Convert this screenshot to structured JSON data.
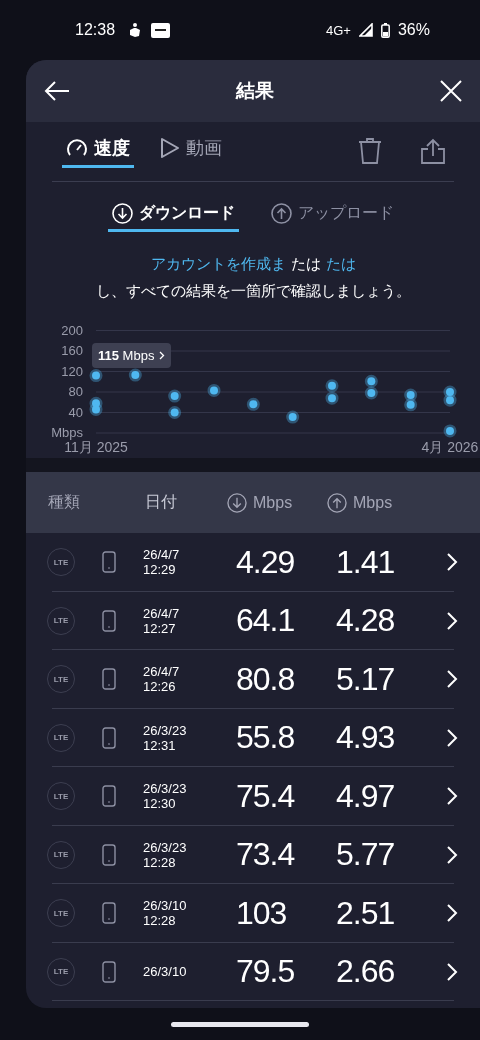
{
  "status_bar": {
    "time": "12:38",
    "network": "4G+",
    "battery": "36%"
  },
  "header": {
    "title": "結果"
  },
  "tabs": [
    {
      "label": "速度",
      "kind": "speed",
      "selected": true
    },
    {
      "label": "動画",
      "kind": "video",
      "selected": false
    }
  ],
  "direction_tabs": [
    {
      "label": "ダウンロード",
      "kind": "download",
      "selected": true
    },
    {
      "label": "アップロード",
      "kind": "upload",
      "selected": false
    }
  ],
  "notice": {
    "lines": [
      [
        {
          "text": "アカウントを作成ま",
          "link": true
        },
        {
          "text": "たは",
          "link": false
        },
        {
          "text": "たは",
          "link": true
        }
      ],
      [
        {
          "text": "し、すべての結果を一箇所で確認しましょう。",
          "link": false
        }
      ]
    ]
  },
  "chart": {
    "tooltip": "**115** Mbps",
    "chart_data": {
      "type": "scatter",
      "ylabel": "Mbps",
      "ylim": [
        0,
        200
      ],
      "yticks": [
        40,
        80,
        120,
        160,
        200
      ],
      "grid": true,
      "categories": [
        "11月 2025",
        null,
        null,
        null,
        null,
        null,
        null,
        null,
        null,
        "4月 2026"
      ],
      "series": [
        {
          "color": "#4fb8f0",
          "values": [
            112,
            113,
            72,
            83,
            56,
            31,
            92,
            101,
            74,
            80
          ]
        },
        {
          "color": "#4fb8f0",
          "values": [
            58,
            null,
            40,
            null,
            null,
            null,
            68,
            78,
            55,
            64
          ]
        },
        {
          "color": "#4fb8f0",
          "values": [
            46,
            null,
            null,
            null,
            null,
            null,
            null,
            null,
            null,
            4
          ]
        }
      ]
    }
  },
  "table": {
    "columns": [
      {
        "label": "種類",
        "kind": "text"
      },
      {
        "label": "日付",
        "kind": "text"
      },
      {
        "label": "Mbps",
        "kind": "download"
      },
      {
        "label": "Mbps",
        "kind": "upload"
      }
    ],
    "rows": [
      {
        "type": "LTE",
        "date": "26/4/7",
        "time": "12:29",
        "download": "4.29",
        "upload": "1.41"
      },
      {
        "type": "LTE",
        "date": "26/4/7",
        "time": "12:27",
        "download": "64.1",
        "upload": "4.28"
      },
      {
        "type": "LTE",
        "date": "26/4/7",
        "time": "12:26",
        "download": "80.8",
        "upload": "5.17"
      },
      {
        "type": "LTE",
        "date": "26/3/23",
        "time": "12:31",
        "download": "55.8",
        "upload": "4.93"
      },
      {
        "type": "LTE",
        "date": "26/3/23",
        "time": "12:30",
        "download": "75.4",
        "upload": "4.97"
      },
      {
        "type": "LTE",
        "date": "26/3/23",
        "time": "12:28",
        "download": "73.4",
        "upload": "5.77"
      },
      {
        "type": "LTE",
        "date": "26/3/10",
        "time": "12:28",
        "download": "103",
        "upload": "2.51"
      },
      {
        "type": "LTE",
        "date": "26/3/10",
        "download": "79.5",
        "upload": "2.66"
      }
    ]
  }
}
